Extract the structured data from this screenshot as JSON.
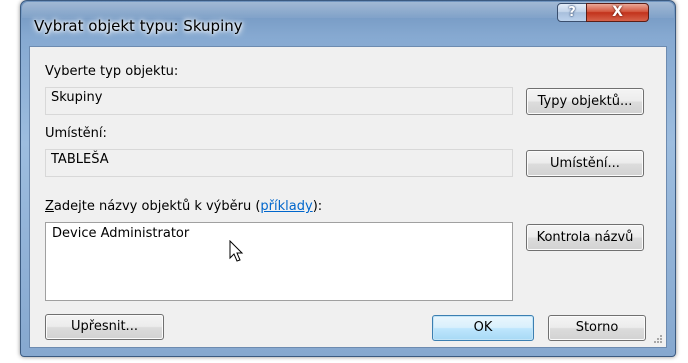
{
  "window": {
    "title": "Vybrat objekt typu: Skupiny",
    "help_label": "?",
    "close_label": "X"
  },
  "object_type": {
    "label": "Vyberte typ objektu:",
    "value": "Skupiny",
    "button_label": "Typy objektů..."
  },
  "location": {
    "label": "Umístění:",
    "value": "TABLEŠA",
    "button_label": "Umístění..."
  },
  "names": {
    "label_underlined": "Z",
    "label_text": "adejte názvy objektů k výběru (",
    "examples_link": "příklady",
    "label_tail": "):",
    "value": "Device Administrator",
    "check_button_label": "Kontrola názvů"
  },
  "footer": {
    "advanced_label": "Upřesnit...",
    "ok_label": "OK",
    "cancel_label": "Storno"
  },
  "colors": {
    "window_frame": "#86a9d1",
    "close_button": "#c2321b",
    "client_background": "#f0f0f0",
    "link": "#0066cc",
    "default_button_border": "#3c7fb1"
  }
}
